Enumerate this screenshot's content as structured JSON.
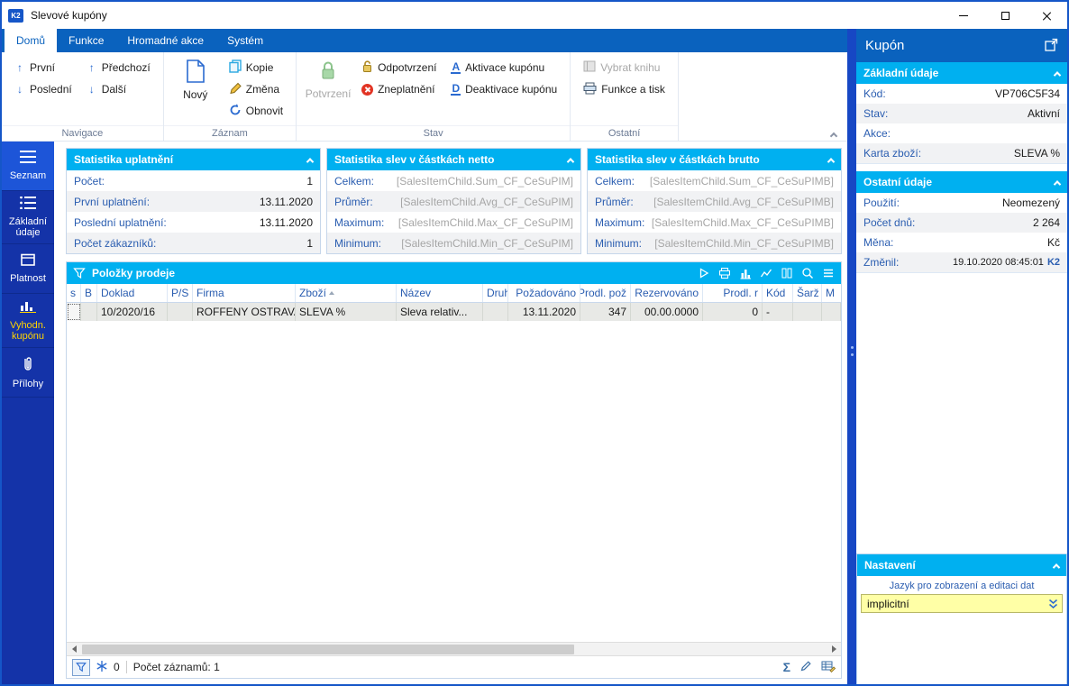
{
  "window": {
    "title": "Slevové kupóny",
    "logo_text": "K2"
  },
  "ribbon": {
    "tabs": [
      "Domů",
      "Funkce",
      "Hromadné akce",
      "Systém"
    ],
    "groups": {
      "navigace": {
        "label": "Navigace",
        "buttons": {
          "prvni": "První",
          "posledni": "Poslední",
          "predchozi": "Předchozí",
          "dalsi": "Další"
        }
      },
      "zaznam": {
        "label": "Záznam",
        "buttons": {
          "novy": "Nový",
          "kopie": "Kopie",
          "zmena": "Změna",
          "obnovit": "Obnovit"
        }
      },
      "stav": {
        "label": "Stav",
        "buttons": {
          "potvrzeni": "Potvrzení",
          "odpotvrzeni": "Odpotvrzení",
          "zneplatneni": "Zneplatnění",
          "aktivace": "Aktivace kupónu",
          "deaktivace": "Deaktivace kupónu"
        }
      },
      "ostatni": {
        "label": "Ostatní",
        "buttons": {
          "vybrat_knihu": "Vybrat knihu",
          "funkce_a_tisk": "Funkce a tisk"
        }
      }
    }
  },
  "sidebar": {
    "items": [
      {
        "label": "Seznam"
      },
      {
        "label": "Základní údaje"
      },
      {
        "label": "Platnost"
      },
      {
        "label": "Vyhodn. kupónu"
      },
      {
        "label": "Přílohy"
      }
    ]
  },
  "stats": {
    "uplatneni": {
      "title": "Statistika uplatnění",
      "rows": [
        {
          "label": "Počet:",
          "value": "1"
        },
        {
          "label": "První uplatnění:",
          "value": "13.11.2020"
        },
        {
          "label": "Poslední uplatnění:",
          "value": "13.11.2020"
        },
        {
          "label": "Počet zákazníků:",
          "value": "1"
        }
      ]
    },
    "netto": {
      "title": "Statistika slev v částkách netto",
      "rows": [
        {
          "label": "Celkem:",
          "value": "[SalesItemChild.Sum_CF_CeSuPIM]"
        },
        {
          "label": "Průměr:",
          "value": "[SalesItemChild.Avg_CF_CeSuPIM]"
        },
        {
          "label": "Maximum:",
          "value": "[SalesItemChild.Max_CF_CeSuPIM]"
        },
        {
          "label": "Minimum:",
          "value": "[SalesItemChild.Min_CF_CeSuPIM]"
        }
      ]
    },
    "brutto": {
      "title": "Statistika slev v částkách brutto",
      "rows": [
        {
          "label": "Celkem:",
          "value": "[SalesItemChild.Sum_CF_CeSuPIMB]"
        },
        {
          "label": "Průměr:",
          "value": "[SalesItemChild.Avg_CF_CeSuPIMB]"
        },
        {
          "label": "Maximum:",
          "value": "[SalesItemChild.Max_CF_CeSuPIMB]"
        },
        {
          "label": "Minimum:",
          "value": "[SalesItemChild.Min_CF_CeSuPIMB]"
        }
      ]
    }
  },
  "grid": {
    "title": "Položky prodeje",
    "columns": [
      "s",
      "B",
      "Doklad",
      "P/S",
      "Firma",
      "Zboží",
      "Název",
      "Druh",
      "Požadováno",
      "Prodl. pož",
      "Rezervováno",
      "Prodl. r",
      "Kód",
      "Šarž",
      "M"
    ],
    "sort_column": "Zboží",
    "row": [
      "",
      "",
      "10/2020/16",
      "",
      "ROFFENY OSTRAVA",
      "SLEVA %",
      "Sleva relativ...",
      "",
      "13.11.2020",
      "347",
      "00.00.0000",
      "0",
      "-",
      "",
      ""
    ],
    "status": {
      "frozen_count": "0",
      "record_count": "Počet záznamů: 1"
    }
  },
  "detail": {
    "title": "Kupón",
    "zakladni": {
      "title": "Základní údaje",
      "rows": [
        {
          "label": "Kód:",
          "value": "VP706C5F34"
        },
        {
          "label": "Stav:",
          "value": "Aktivní"
        },
        {
          "label": "Akce:",
          "value": ""
        },
        {
          "label": "Karta zboží:",
          "value": "SLEVA %"
        }
      ]
    },
    "ostatni": {
      "title": "Ostatní údaje",
      "rows": [
        {
          "label": "Použití:",
          "value": "Neomezený"
        },
        {
          "label": "Počet dnů:",
          "value": "2 264"
        },
        {
          "label": "Měna:",
          "value": "Kč"
        },
        {
          "label": "Změnil:",
          "value": "19.10.2020 08:45:01",
          "user": "K2"
        }
      ]
    },
    "nastaveni": {
      "title": "Nastavení",
      "language_label": "Jazyk pro zobrazení a editaci dat",
      "language_value": "implicitní"
    }
  }
}
